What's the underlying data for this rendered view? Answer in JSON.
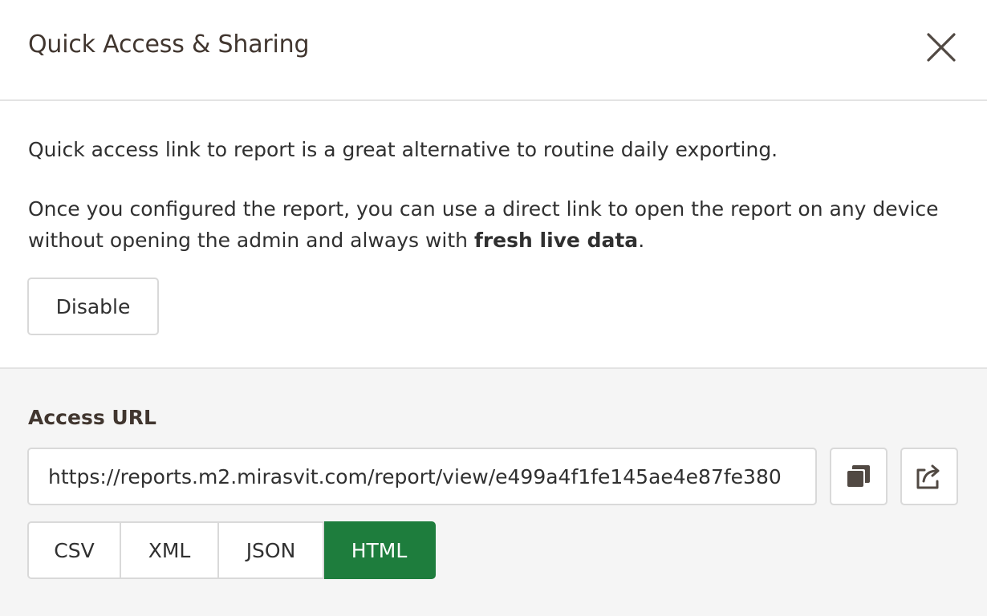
{
  "header": {
    "title": "Quick Access & Sharing",
    "close_icon": "close-icon"
  },
  "intro": {
    "paragraph1": "Quick access link to report is a great alternative to routine daily exporting.",
    "paragraph2_part1": "Once you configured the report, you can use a direct link to open the report on any device without opening the admin and always with ",
    "paragraph2_bold": "fresh live data",
    "paragraph2_end": "."
  },
  "disable_button": {
    "label": "Disable"
  },
  "access": {
    "label": "Access URL",
    "url": "https://reports.m2.mirasvit.com/report/view/e499a4f1fe145ae4e87fe380",
    "copy_icon": "copy-icon",
    "share_icon": "share-icon"
  },
  "formats": {
    "options": [
      "CSV",
      "XML",
      "JSON",
      "HTML"
    ],
    "selected": "HTML"
  },
  "colors": {
    "text": "#41362f",
    "accent": "#1e7d3d",
    "border": "#d9d9d9",
    "footer_bg": "#f5f5f5"
  }
}
